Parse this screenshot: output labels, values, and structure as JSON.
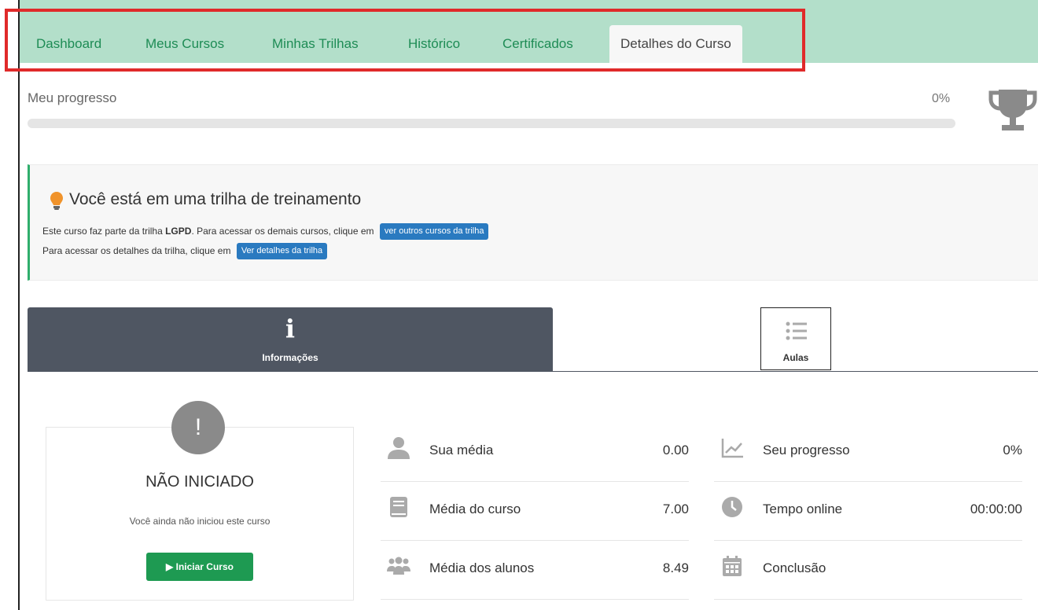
{
  "nav": {
    "items": [
      {
        "label": "Dashboard"
      },
      {
        "label": "Meus Cursos"
      },
      {
        "label": "Minhas Trilhas"
      },
      {
        "label": "Histórico"
      },
      {
        "label": "Certificados"
      },
      {
        "label": "Detalhes do Curso"
      }
    ],
    "active_index": 5
  },
  "progress": {
    "label": "Meu progresso",
    "percent_text": "0%",
    "percent": 0
  },
  "trilha": {
    "title": "Você está em uma trilha de treinamento",
    "line1_prefix": "Este curso faz parte da trilha",
    "line1_trail_name": "LGPD",
    "line1_suffix": ". Para acessar os demais cursos, clique em",
    "line1_button": "ver outros cursos da trilha",
    "line2_prefix": "Para acessar os detalhes da trilha, clique em",
    "line2_button": "Ver detalhes da trilha"
  },
  "tabs": {
    "info_label": "Informações",
    "info_icon_glyph": "i",
    "aulas_label": "Aulas"
  },
  "status": {
    "glyph": "!",
    "title": "NÃO INICIADO",
    "subtitle": "Você ainda não iniciou este curso",
    "button": "Iniciar Curso"
  },
  "stats": {
    "left": [
      {
        "label": "Sua média",
        "value": "0.00",
        "icon": "user-icon"
      },
      {
        "label": "Média do curso",
        "value": "7.00",
        "icon": "book-icon"
      },
      {
        "label": "Média dos alunos",
        "value": "8.49",
        "icon": "users-icon"
      }
    ],
    "right": [
      {
        "label": "Seu progresso",
        "value": "0%",
        "icon": "line-chart-icon"
      },
      {
        "label": "Tempo online",
        "value": "00:00:00",
        "icon": "clock-icon"
      },
      {
        "label": "Conclusão",
        "value": "",
        "icon": "calendar-icon"
      }
    ]
  },
  "colors": {
    "nav_bg": "#b3dfca",
    "nav_link": "#1e8c55",
    "accent_blue": "#2a7ac0",
    "accent_green": "#1e9a52",
    "tab_dark": "#4f5662",
    "highlight": "#e02a2a"
  }
}
